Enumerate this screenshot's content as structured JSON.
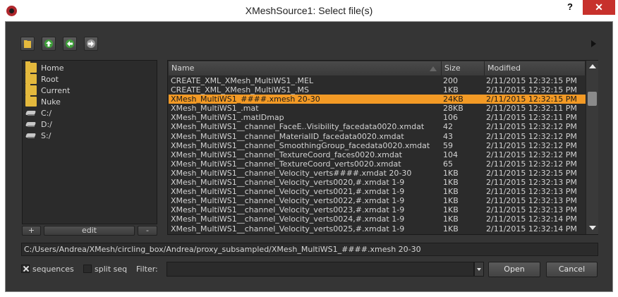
{
  "window": {
    "title": "XMeshSource1: Select file(s)",
    "help_label": "?",
    "close_label": "✕"
  },
  "toolbar": {
    "buttons": [
      "folder-icon",
      "up-arrow-icon",
      "back-arrow-icon",
      "forward-arrow-icon"
    ]
  },
  "favorites": {
    "items": [
      {
        "label": "Home",
        "icon": "home-folder-icon"
      },
      {
        "label": "Root",
        "icon": "folder-icon"
      },
      {
        "label": "Current",
        "icon": "folder-icon"
      },
      {
        "label": "Nuke",
        "icon": "folder-icon"
      },
      {
        "label": "C:/",
        "icon": "drive-icon"
      },
      {
        "label": "D:/",
        "icon": "drive-icon"
      },
      {
        "label": "S:/",
        "icon": "drive-icon"
      }
    ],
    "add_label": "+",
    "edit_label": "edit",
    "remove_label": "-"
  },
  "file_list": {
    "columns": {
      "name": "Name",
      "size": "Size",
      "modified": "Modified"
    },
    "selected_index": 2,
    "rows": [
      {
        "name": "CREATE_XML_XMesh_MultiWS1_.MEL",
        "size": "200",
        "modified": "2/11/2015 12:32:15 PM"
      },
      {
        "name": "CREATE_XML_XMesh_MultiWS1_.MS",
        "size": "1KB",
        "modified": "2/11/2015 12:32:15 PM"
      },
      {
        "name": "XMesh_MultiWS1_####.xmesh 20-30",
        "size": "24KB",
        "modified": "2/11/2015 12:32:15 PM"
      },
      {
        "name": "XMesh_MultiWS1_.mat",
        "size": "28KB",
        "modified": "2/11/2015 12:32:11 PM"
      },
      {
        "name": "XMesh_MultiWS1_.matIDmap",
        "size": "106",
        "modified": "2/11/2015 12:32:11 PM"
      },
      {
        "name": "XMesh_MultiWS1__channel_FaceE..Visibility_facedata0020.xmdat",
        "size": "42",
        "modified": "2/11/2015 12:32:12 PM"
      },
      {
        "name": "XMesh_MultiWS1__channel_MaterialID_facedata0020.xmdat",
        "size": "43",
        "modified": "2/11/2015 12:32:12 PM"
      },
      {
        "name": "XMesh_MultiWS1__channel_SmoothingGroup_facedata0020.xmdat",
        "size": "59",
        "modified": "2/11/2015 12:32:12 PM"
      },
      {
        "name": "XMesh_MultiWS1__channel_TextureCoord_faces0020.xmdat",
        "size": "104",
        "modified": "2/11/2015 12:32:12 PM"
      },
      {
        "name": "XMesh_MultiWS1__channel_TextureCoord_verts0020.xmdat",
        "size": "65",
        "modified": "2/11/2015 12:32:12 PM"
      },
      {
        "name": "XMesh_MultiWS1__channel_Velocity_verts####.xmdat 20-30",
        "size": "1KB",
        "modified": "2/11/2015 12:32:15 PM"
      },
      {
        "name": "XMesh_MultiWS1__channel_Velocity_verts0020,#.xmdat 1-9",
        "size": "1KB",
        "modified": "2/11/2015 12:32:13 PM"
      },
      {
        "name": "XMesh_MultiWS1__channel_Velocity_verts0021,#.xmdat 1-9",
        "size": "1KB",
        "modified": "2/11/2015 12:32:13 PM"
      },
      {
        "name": "XMesh_MultiWS1__channel_Velocity_verts0022,#.xmdat 1-9",
        "size": "1KB",
        "modified": "2/11/2015 12:32:13 PM"
      },
      {
        "name": "XMesh_MultiWS1__channel_Velocity_verts0023,#.xmdat 1-9",
        "size": "1KB",
        "modified": "2/11/2015 12:32:13 PM"
      },
      {
        "name": "XMesh_MultiWS1__channel_Velocity_verts0024,#.xmdat 1-9",
        "size": "1KB",
        "modified": "2/11/2015 12:32:14 PM"
      },
      {
        "name": "XMesh_MultiWS1__channel_Velocity_verts0025,#.xmdat 1-9",
        "size": "1KB",
        "modified": "2/11/2015 12:32:14 PM"
      }
    ]
  },
  "path": {
    "value": "C:/Users/Andrea/XMesh/circling_box/Andrea/proxy_subsampled/XMesh_MultiWS1_####.xmesh 20-30"
  },
  "options": {
    "sequences_label": "sequences",
    "sequences_checked": true,
    "split_seq_label": "split seq",
    "split_seq_checked": false,
    "filter_label": "Filter:",
    "filter_value": ""
  },
  "actions": {
    "open_label": "Open",
    "cancel_label": "Cancel"
  },
  "colors": {
    "selection": "#f39a25",
    "panel_bg": "#2b2b2b",
    "window_bg": "#353535",
    "close_red": "#c7312c"
  }
}
